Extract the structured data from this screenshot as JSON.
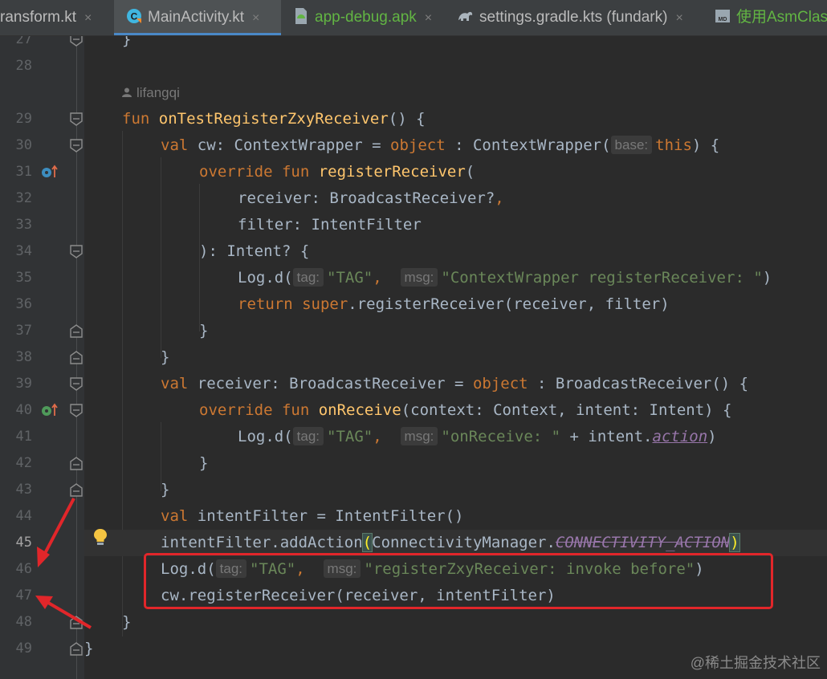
{
  "tabs": [
    {
      "label": "ransform.kt",
      "active": false,
      "icon": "kotlin-file-icon"
    },
    {
      "label": "MainActivity.kt",
      "active": true,
      "icon": "kotlin-class-icon"
    },
    {
      "label": "app-debug.apk",
      "active": false,
      "icon": "apk-file-icon"
    },
    {
      "label": "settings.gradle.kts (fundark)",
      "active": false,
      "icon": "gradle-icon"
    },
    {
      "label": "使用AsmClass",
      "active": false,
      "icon": "markdown-icon"
    }
  ],
  "close_glyph": "×",
  "gutter": {
    "line_numbers": [
      "27",
      "28",
      "",
      "29",
      "30",
      "31",
      "32",
      "33",
      "34",
      "35",
      "36",
      "37",
      "38",
      "39",
      "40",
      "41",
      "42",
      "43",
      "44",
      "45",
      "46",
      "47",
      "48",
      "49"
    ],
    "current_line": "45"
  },
  "code": {
    "author": "lifangqi",
    "lines": {
      "l27": "}",
      "l29_kw": "fun",
      "l29_name": "onTestRegisterZxyReceiver",
      "l29_rest": "() {",
      "l30_kw1": "val",
      "l30_a": " cw: ContextWrapper = ",
      "l30_kw2": "object",
      "l30_b": " : ContextWrapper(",
      "l30_hint": "base:",
      "l30_kw3": "this",
      "l30_c": ") {",
      "l31_kw": "override fun",
      "l31_name": "registerReceiver",
      "l31_rest": "(",
      "l32": "receiver: BroadcastReceiver?",
      "l32_comma": ",",
      "l33": "filter: IntentFilter",
      "l34": "): Intent? {",
      "l35_a": "Log.d(",
      "l35_hint1": "tag:",
      "l35_str1": "\"TAG\"",
      "l35_comma": ",",
      "l35_hint2": "msg:",
      "l35_str2": "\"ContextWrapper registerReceiver: \"",
      "l35_end": ")",
      "l36_kw": "return",
      "l36_kw2": "super",
      "l36_rest": ".registerReceiver(receiver, filter)",
      "l37": "}",
      "l38": "}",
      "l39_kw1": "val",
      "l39_a": " receiver: BroadcastReceiver = ",
      "l39_kw2": "object",
      "l39_b": " : BroadcastReceiver() {",
      "l40_kw": "override fun",
      "l40_name": "onReceive",
      "l40_rest": "(context: Context, intent: Intent) {",
      "l41_a": "Log.d(",
      "l41_hint1": "tag:",
      "l41_str1": "\"TAG\"",
      "l41_comma": ",",
      "l41_hint2": "msg:",
      "l41_str2": "\"onReceive: \"",
      "l41_b": " + intent.",
      "l41_field": "action",
      "l41_end": ")",
      "l42": "}",
      "l43": "}",
      "l44_kw": "val",
      "l44_rest": " intentFilter = IntentFilter()",
      "l45_a": "intentFilter.addAction",
      "l45_open": "(",
      "l45_b": "ConnectivityManager.",
      "l45_const": "CONNECTIVITY_ACTION",
      "l45_close": ")",
      "l46_a": "Log.d(",
      "l46_hint1": "tag:",
      "l46_str1": "\"TAG\"",
      "l46_comma": ",",
      "l46_hint2": "msg:",
      "l46_str2": "\"registerZxyReceiver: invoke before\"",
      "l46_end": ")",
      "l47": "cw.registerReceiver(receiver, intentFilter)",
      "l48": "}",
      "l49": "}"
    }
  },
  "colors": {
    "keyword": "#cc7832",
    "function": "#ffc66d",
    "string": "#6a8759",
    "field": "#9876aa",
    "annotation_red": "#e1262a"
  },
  "watermark": "@稀土掘金技术社区"
}
